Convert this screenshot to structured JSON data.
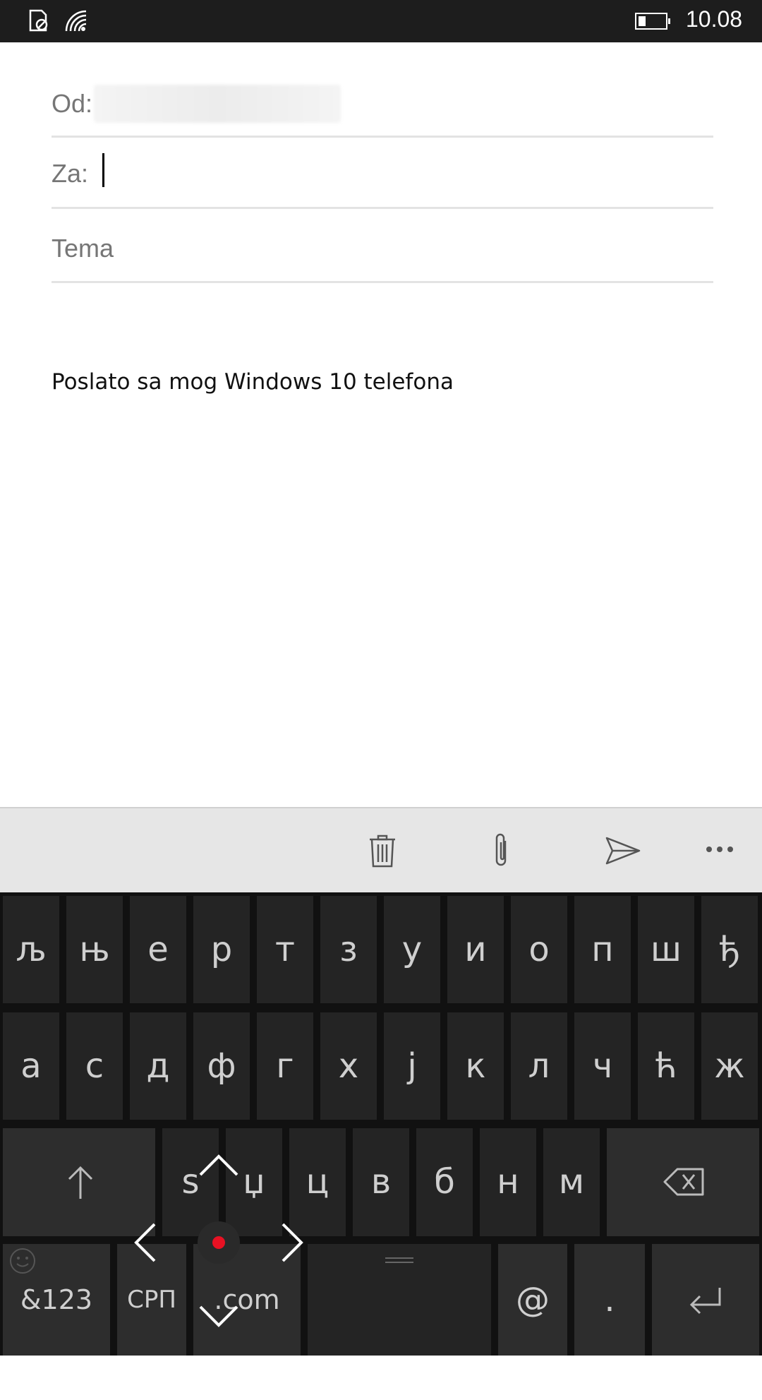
{
  "status_bar": {
    "time": "10.08",
    "icons": [
      "notification-icon",
      "wifi-icon",
      "battery-icon"
    ]
  },
  "compose": {
    "from_label": "Od:",
    "to_label": "Za:",
    "subject_placeholder": "Tema",
    "body_signature": "Poslato sa mog Windows 10 telefona"
  },
  "app_bar": {
    "buttons": [
      "delete-icon",
      "attach-icon",
      "send-icon",
      "more-icon"
    ]
  },
  "keyboard": {
    "row1": [
      "љ",
      "њ",
      "е",
      "р",
      "т",
      "з",
      "у",
      "и",
      "о",
      "п",
      "ш",
      "ђ"
    ],
    "row2": [
      "а",
      "с",
      "д",
      "ф",
      "г",
      "х",
      "ј",
      "к",
      "л",
      "ч",
      "ћ",
      "ж"
    ],
    "row3": [
      "s",
      "џ",
      "ц",
      "в",
      "б",
      "н",
      "м"
    ],
    "row4": {
      "symbols": "&123",
      "language": "СРП",
      "dotcom": ".com",
      "at": "@",
      "period": "."
    }
  },
  "colors": {
    "keyboard_bg": "#111111",
    "key_bg": "#242424",
    "app_bar_bg": "#e6e6e6",
    "cursor_dot": "#e81123"
  }
}
